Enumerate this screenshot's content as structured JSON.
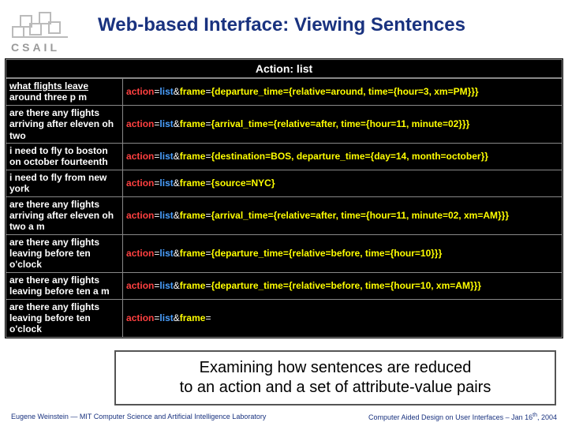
{
  "logo_text": "CSAIL",
  "title": "Web-based Interface: Viewing Sentences",
  "action_header": "Action: list",
  "rows": [
    {
      "sentence_link": "what flights leave",
      "sentence_rest": " around three p m",
      "frame_rest": "{departure_time={relative=around, time={hour=3, xm=PM}}}"
    },
    {
      "sentence_link": "",
      "sentence_rest": "are there any flights arriving after eleven oh two",
      "frame_rest": "{arrival_time={relative=after, time={hour=11, minute=02}}}"
    },
    {
      "sentence_link": "",
      "sentence_rest": "i need to fly to boston on october fourteenth",
      "frame_rest": "{destination=BOS, departure_time={day=14, month=october}}"
    },
    {
      "sentence_link": "",
      "sentence_rest": "i need to fly from new york",
      "frame_rest": "{source=NYC}"
    },
    {
      "sentence_link": "",
      "sentence_rest": "are there any flights arriving after eleven oh two a m",
      "frame_rest": "{arrival_time={relative=after, time={hour=11, minute=02, xm=AM}}}"
    },
    {
      "sentence_link": "",
      "sentence_rest": "are there any flights leaving before ten o'clock",
      "frame_rest": "{departure_time={relative=before, time={hour=10}}}"
    },
    {
      "sentence_link": "",
      "sentence_rest": "are there any flights leaving before ten a m",
      "frame_rest": "{departure_time={relative=before, time={hour=10, xm=AM}}}"
    },
    {
      "sentence_link": "",
      "sentence_rest": "are there any flights leaving before ten o'clock",
      "frame_rest": ""
    }
  ],
  "frame_tokens": {
    "action": "action",
    "val": "list",
    "frame": "frame"
  },
  "callout_line1": "Examining how sentences are reduced",
  "callout_line2": "to an action and a set of attribute-value pairs",
  "footer_left": "Eugene Weinstein — MIT Computer Science and Artificial Intelligence Laboratory",
  "footer_right_pre": "Computer Aided Design on User Interfaces – Jan 16",
  "footer_right_sup": "th",
  "footer_right_post": ", 2004"
}
